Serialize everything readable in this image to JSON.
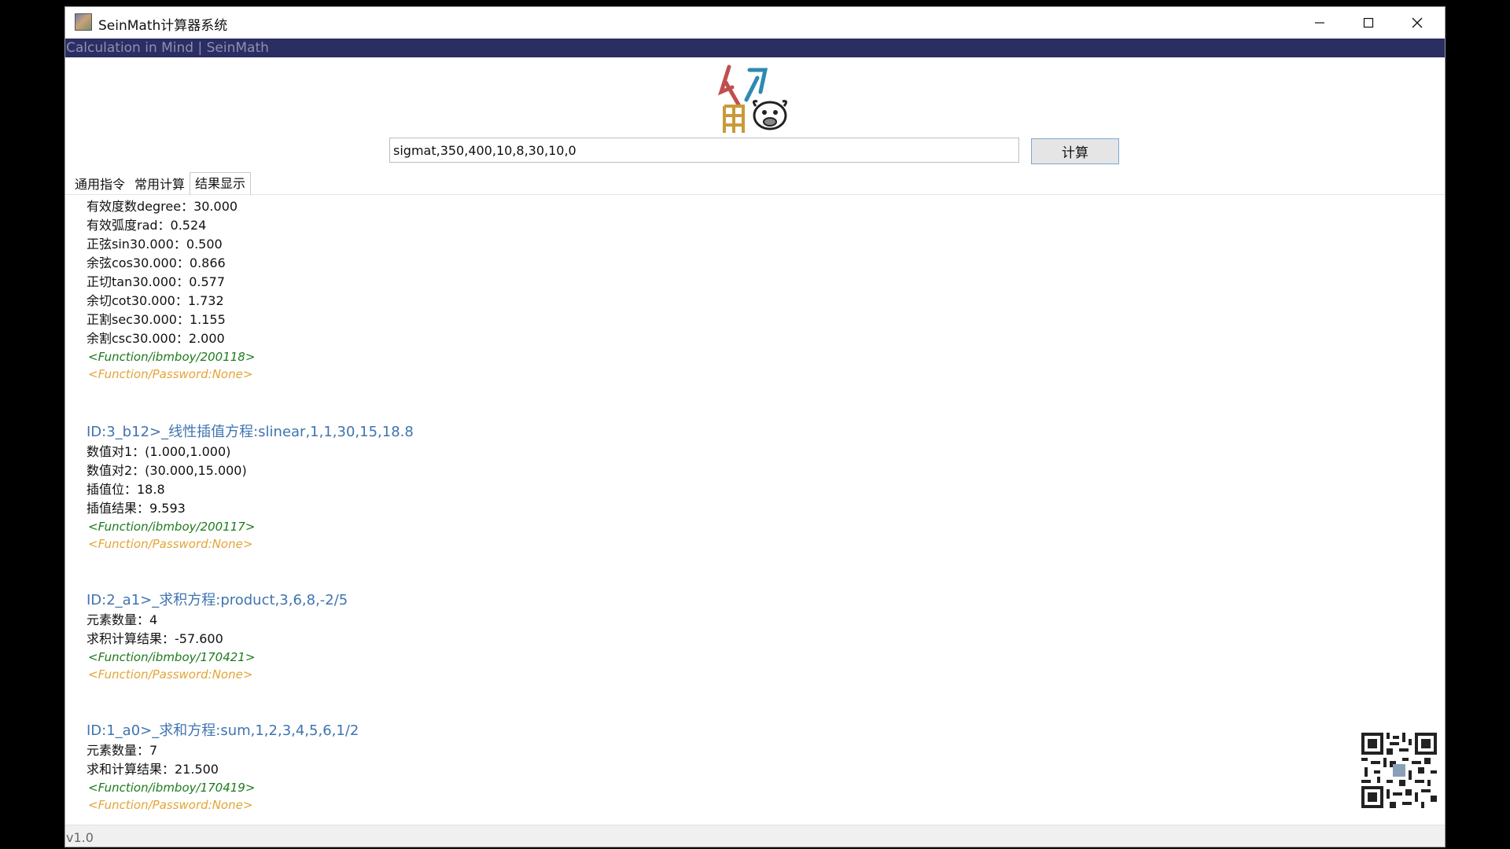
{
  "window": {
    "title": "SeinMath计算器系统",
    "banner": "Calculation in Mind | SeinMath",
    "version": "v1.0"
  },
  "icons": {
    "app": "app-icon",
    "logo": "seinmath-logo-icon",
    "qr": "qr-code-icon",
    "minimize": "minimize-icon",
    "maximize": "maximize-icon",
    "close": "close-icon"
  },
  "command": {
    "value": "sigmat,350,400,10,8,30,10,0",
    "button_label": "计算"
  },
  "tabs": [
    {
      "label": "通用指令"
    },
    {
      "label": "常用计算"
    },
    {
      "label": "结果显示",
      "active": true
    }
  ],
  "results": [
    {
      "title": "",
      "lines": [
        "有效度数degree：30.000",
        "有效弧度rad：0.524",
        "正弦sin30.000：0.500",
        "余弦cos30.000：0.866",
        "正切tan30.000：0.577",
        "余切cot30.000：1.732",
        "正割sec30.000：1.155",
        "余割csc30.000：2.000"
      ],
      "function_tag": "<Function/ibmboy/200118>",
      "password_tag": "<Function/Password:None>"
    },
    {
      "title": "ID:3_b12>_线性插值方程:slinear,1,1,30,15,18.8",
      "lines": [
        "数值对1：(1.000,1.000)",
        "数值对2：(30.000,15.000)",
        "插值位：18.8",
        "插值结果：9.593"
      ],
      "function_tag": "<Function/ibmboy/200117>",
      "password_tag": "<Function/Password:None>"
    },
    {
      "title": "ID:2_a1>_求积方程:product,3,6,8,-2/5",
      "lines": [
        "元素数量：4",
        "求积计算结果：-57.600"
      ],
      "function_tag": "<Function/ibmboy/170421>",
      "password_tag": "<Function/Password:None>"
    },
    {
      "title": "ID:1_a0>_求和方程:sum,1,2,3,4,5,6,1/2",
      "lines": [
        "元素数量：7",
        "求和计算结果：21.500"
      ],
      "function_tag": "<Function/ibmboy/170419>",
      "password_tag": "<Function/Password:None>"
    }
  ]
}
